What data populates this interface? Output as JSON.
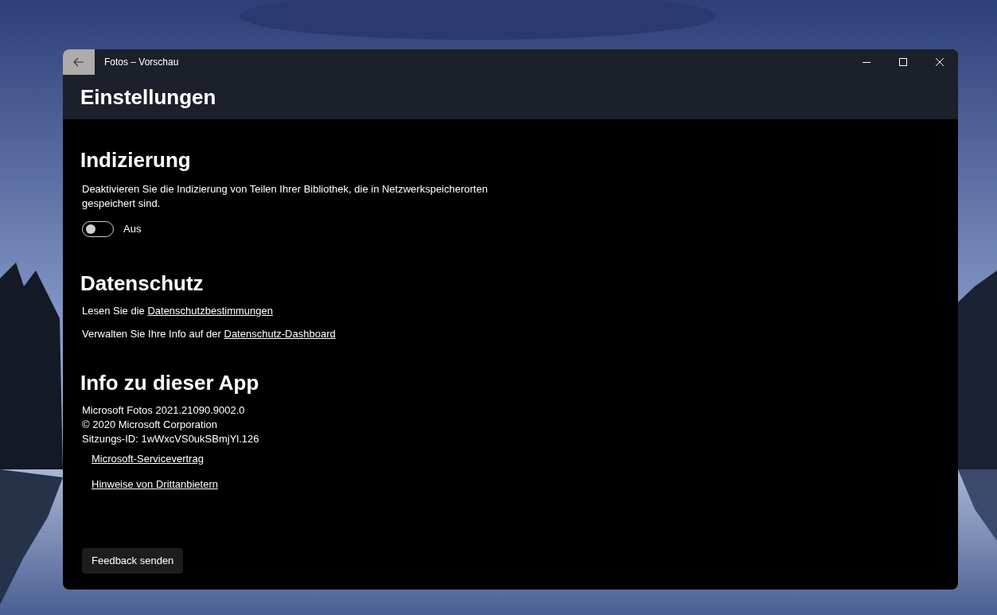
{
  "window": {
    "title": "Fotos – Vorschau"
  },
  "page_title": "Einstellungen",
  "indexing": {
    "heading": "Indizierung",
    "description": "Deaktivieren Sie die Indizierung von Teilen Ihrer Bibliothek, die in Netzwerkspeicherorten gespeichert sind.",
    "toggle": {
      "on": false,
      "label": "Aus"
    }
  },
  "privacy": {
    "heading": "Datenschutz",
    "lines": [
      {
        "text": "Lesen Sie die ",
        "link": "Datenschutzbestimmungen"
      },
      {
        "text": "Verwalten Sie Ihre Info auf der ",
        "link": "Datenschutz-Dashboard"
      }
    ]
  },
  "about": {
    "heading": "Info zu dieser App",
    "info": [
      "Microsoft Fotos 2021.21090.9002.0",
      "© 2020 Microsoft Corporation",
      "Sitzungs-ID: 1wWxcVS0ukSBmjYl.126"
    ],
    "links": [
      "Microsoft-Servicevertrag",
      "Hinweise von Drittanbietern"
    ]
  },
  "feedback_button": "Feedback senden"
}
